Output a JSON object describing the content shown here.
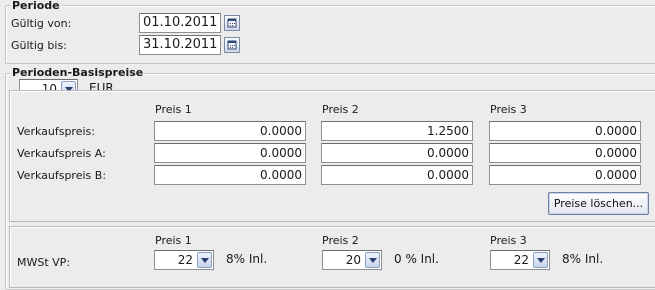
{
  "periode": {
    "title": "Periode",
    "valid_from_label": "Gültig von:",
    "valid_from_value": "01.10.2011",
    "valid_to_label": "Gültig bis:",
    "valid_to_value": "31.10.2011"
  },
  "basispreise": {
    "title": "Perioden-Basispreise",
    "quantity": "10",
    "currency": "EUR",
    "columns": [
      "Preis 1",
      "Preis 2",
      "Preis 3"
    ],
    "rows": [
      {
        "label": "Verkaufspreis:",
        "values": [
          "0.0000",
          "1.2500",
          "0.0000"
        ]
      },
      {
        "label": "Verkaufspreis A:",
        "values": [
          "0.0000",
          "0.0000",
          "0.0000"
        ]
      },
      {
        "label": "Verkaufspreis B:",
        "values": [
          "0.0000",
          "0.0000",
          "0.0000"
        ]
      }
    ],
    "clear_button": "Preise löschen..."
  },
  "mwst": {
    "columns": [
      "Preis 1",
      "Preis 2",
      "Preis 3"
    ],
    "label": "MWSt VP:",
    "codes": [
      "22",
      "20",
      "22"
    ],
    "descriptions": [
      "8% Inl.",
      "0 % Inl.",
      "8% Inl."
    ]
  },
  "icons": {
    "calendar": "calendar-icon",
    "dropdown": "chevron-down-icon"
  }
}
